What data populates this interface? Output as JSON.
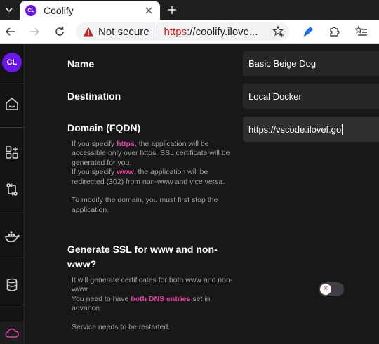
{
  "browser": {
    "tab_title": "Coolify",
    "tab_favicon_text": "CL",
    "security_label": "Not secure",
    "url_scheme": "https",
    "url_rest": "://coolify.ilove..."
  },
  "sidebar": {
    "avatar_text": "CL",
    "items": [
      {
        "icon": "home-icon"
      },
      {
        "icon": "grid-icon"
      },
      {
        "icon": "git-branch-icon"
      },
      {
        "icon": "docker-icon"
      },
      {
        "icon": "database-icon"
      },
      {
        "icon": "cloud-icon",
        "active": true
      }
    ]
  },
  "form": {
    "name": {
      "label": "Name",
      "value": "Basic Beige Dog"
    },
    "destination": {
      "label": "Destination",
      "value": "Local Docker"
    },
    "domain": {
      "label": "Domain (FQDN)",
      "value": "https://vscode.ilovef.go",
      "help": {
        "p1_a": "If you specify ",
        "p1_hl": "https",
        "p1_b": ", the application will be accessible only over https. SSL certificate will be generated for you.",
        "p2_a": "If you specify ",
        "p2_hl": "www",
        "p2_b": ", the application will be redirected (302) from non-www and vice versa.",
        "p3": "To modify the domain, you must first stop the application."
      }
    },
    "ssl": {
      "label": "Generate SSL for www and non-www?",
      "toggle_on": false,
      "help": {
        "p1": "It will generate certificates for both www and non-www.",
        "p2_a": "You need to have ",
        "p2_hl": "both DNS entries",
        "p2_b": " set in advance.",
        "p3": "Service needs to be restarted."
      }
    }
  },
  "colors": {
    "accent": "#6b16ed",
    "highlight": "#ea3ba6",
    "background": "#181818"
  }
}
